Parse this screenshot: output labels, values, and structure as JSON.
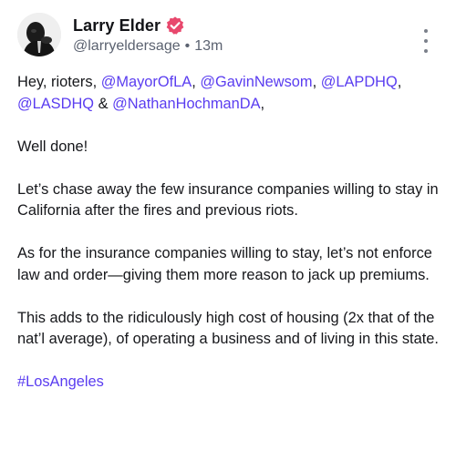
{
  "post": {
    "author": {
      "display_name": "Larry Elder",
      "handle": "@larryeldersage",
      "verified": true,
      "verified_icon": "verified-badge-icon",
      "verified_color": "#e8486d"
    },
    "time_ago": "13m",
    "separator": "•",
    "menu_icon": "more-vertical-icon",
    "greeting": "Hey, rioters,",
    "mentions": [
      "@MayorOfLA",
      "@GavinNewsom",
      "@LAPDHQ",
      "@LASDHQ",
      "@NathanHochmanDA"
    ],
    "mention_separator": ",",
    "ampersand": "&",
    "paragraphs": [
      "Well done!",
      "Let’s chase away the few insurance companies willing to stay in California after the fires and previous riots.",
      "As for the insurance companies willing to stay, let’s not enforce law and order—giving them more reason to jack up premiums.",
      "This adds to the ridiculously high cost of housing (2x that of the nat’l average), of operating a business and of living in this state."
    ],
    "hashtag": "#LosAngeles",
    "link_color": "#5a3df0"
  }
}
